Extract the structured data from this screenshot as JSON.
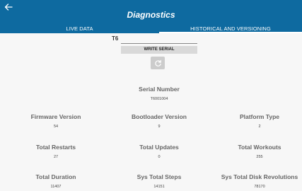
{
  "header": {
    "back_icon": "arrow-left-icon",
    "title": "Diagnostics",
    "tabs": [
      {
        "label": "LIVE DATA",
        "active": false
      },
      {
        "label": "HISTORICAL AND VERSIONING",
        "active": true
      }
    ],
    "color": "#0e6aa0"
  },
  "serial_form": {
    "prefix": "T6",
    "input_value": "",
    "write_label": "WRITE SERIAL",
    "refresh_icon": "refresh-icon"
  },
  "stats": {
    "serial_number": {
      "label": "Serial Number",
      "value": "T6001004"
    },
    "firmware_version": {
      "label": "Firmware Version",
      "value": "54"
    },
    "bootloader_version": {
      "label": "Bootloader Version",
      "value": "9"
    },
    "platform_type": {
      "label": "Platform Type",
      "value": "2"
    },
    "total_restarts": {
      "label": "Total Restarts",
      "value": "27"
    },
    "total_updates": {
      "label": "Total Updates",
      "value": "0"
    },
    "total_workouts": {
      "label": "Total Workouts",
      "value": "255"
    },
    "total_duration": {
      "label": "Total Duration",
      "value": "11407"
    },
    "sys_total_steps": {
      "label": "Sys Total Steps",
      "value": "14151"
    },
    "sys_total_disk_revolutions": {
      "label": "Sys Total Disk Revolutions",
      "value": "78170"
    }
  }
}
